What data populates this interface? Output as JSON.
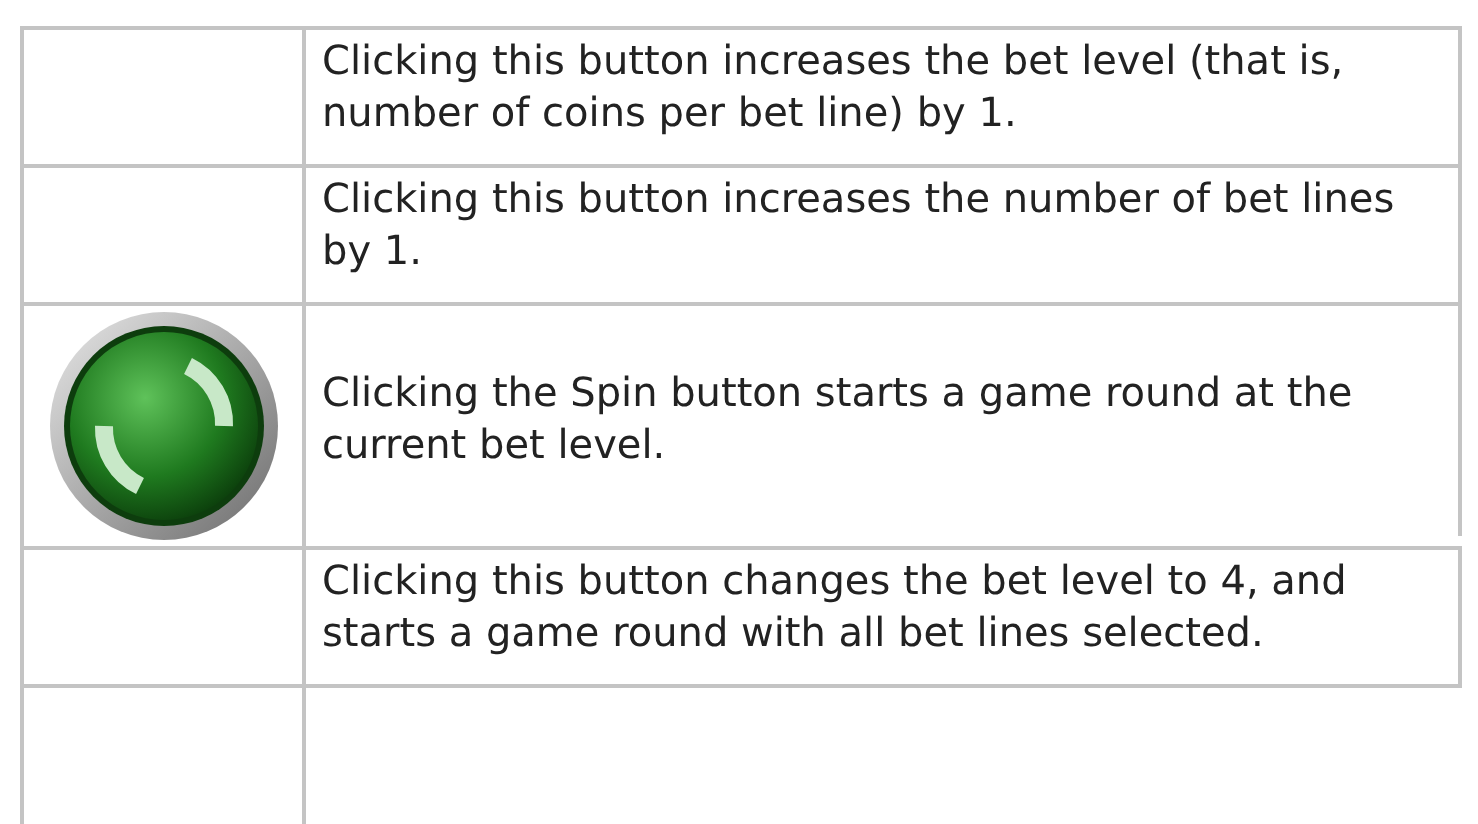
{
  "rows": [
    {
      "kind": "plain",
      "description": "Clicking this button increases the bet level (that is, number of coins per bet line) by 1."
    },
    {
      "kind": "plain",
      "description": "Clicking this button increases the number of bet lines by 1."
    },
    {
      "kind": "spin",
      "description": "Clicking the Spin button starts a game round at the current bet level."
    },
    {
      "kind": "plain",
      "description": "Clicking this button changes the bet level to 4, and starts a game round with all bet lines selected."
    }
  ]
}
